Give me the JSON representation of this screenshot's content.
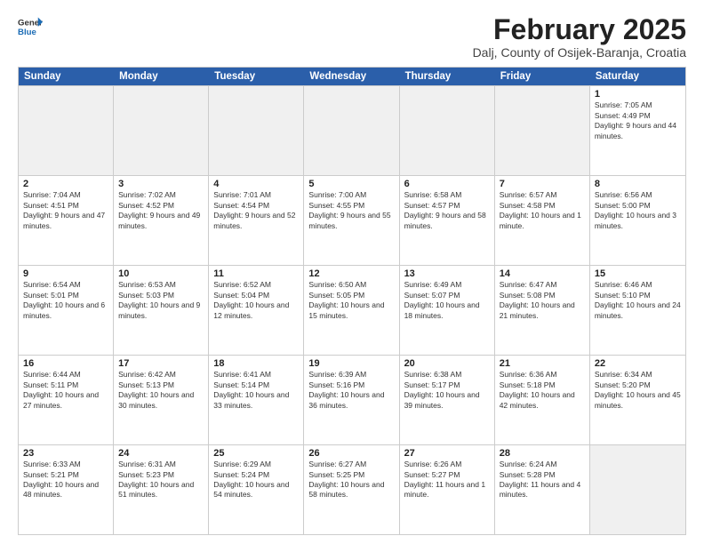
{
  "header": {
    "logo_general": "General",
    "logo_blue": "Blue",
    "main_title": "February 2025",
    "subtitle": "Dalj, County of Osijek-Baranja, Croatia"
  },
  "days_of_week": [
    "Sunday",
    "Monday",
    "Tuesday",
    "Wednesday",
    "Thursday",
    "Friday",
    "Saturday"
  ],
  "weeks": [
    [
      {
        "day": "",
        "info": "",
        "shaded": true
      },
      {
        "day": "",
        "info": "",
        "shaded": true
      },
      {
        "day": "",
        "info": "",
        "shaded": true
      },
      {
        "day": "",
        "info": "",
        "shaded": true
      },
      {
        "day": "",
        "info": "",
        "shaded": true
      },
      {
        "day": "",
        "info": "",
        "shaded": true
      },
      {
        "day": "1",
        "info": "Sunrise: 7:05 AM\nSunset: 4:49 PM\nDaylight: 9 hours and 44 minutes."
      }
    ],
    [
      {
        "day": "2",
        "info": "Sunrise: 7:04 AM\nSunset: 4:51 PM\nDaylight: 9 hours and 47 minutes."
      },
      {
        "day": "3",
        "info": "Sunrise: 7:02 AM\nSunset: 4:52 PM\nDaylight: 9 hours and 49 minutes."
      },
      {
        "day": "4",
        "info": "Sunrise: 7:01 AM\nSunset: 4:54 PM\nDaylight: 9 hours and 52 minutes."
      },
      {
        "day": "5",
        "info": "Sunrise: 7:00 AM\nSunset: 4:55 PM\nDaylight: 9 hours and 55 minutes."
      },
      {
        "day": "6",
        "info": "Sunrise: 6:58 AM\nSunset: 4:57 PM\nDaylight: 9 hours and 58 minutes."
      },
      {
        "day": "7",
        "info": "Sunrise: 6:57 AM\nSunset: 4:58 PM\nDaylight: 10 hours and 1 minute."
      },
      {
        "day": "8",
        "info": "Sunrise: 6:56 AM\nSunset: 5:00 PM\nDaylight: 10 hours and 3 minutes."
      }
    ],
    [
      {
        "day": "9",
        "info": "Sunrise: 6:54 AM\nSunset: 5:01 PM\nDaylight: 10 hours and 6 minutes."
      },
      {
        "day": "10",
        "info": "Sunrise: 6:53 AM\nSunset: 5:03 PM\nDaylight: 10 hours and 9 minutes."
      },
      {
        "day": "11",
        "info": "Sunrise: 6:52 AM\nSunset: 5:04 PM\nDaylight: 10 hours and 12 minutes."
      },
      {
        "day": "12",
        "info": "Sunrise: 6:50 AM\nSunset: 5:05 PM\nDaylight: 10 hours and 15 minutes."
      },
      {
        "day": "13",
        "info": "Sunrise: 6:49 AM\nSunset: 5:07 PM\nDaylight: 10 hours and 18 minutes."
      },
      {
        "day": "14",
        "info": "Sunrise: 6:47 AM\nSunset: 5:08 PM\nDaylight: 10 hours and 21 minutes."
      },
      {
        "day": "15",
        "info": "Sunrise: 6:46 AM\nSunset: 5:10 PM\nDaylight: 10 hours and 24 minutes."
      }
    ],
    [
      {
        "day": "16",
        "info": "Sunrise: 6:44 AM\nSunset: 5:11 PM\nDaylight: 10 hours and 27 minutes."
      },
      {
        "day": "17",
        "info": "Sunrise: 6:42 AM\nSunset: 5:13 PM\nDaylight: 10 hours and 30 minutes."
      },
      {
        "day": "18",
        "info": "Sunrise: 6:41 AM\nSunset: 5:14 PM\nDaylight: 10 hours and 33 minutes."
      },
      {
        "day": "19",
        "info": "Sunrise: 6:39 AM\nSunset: 5:16 PM\nDaylight: 10 hours and 36 minutes."
      },
      {
        "day": "20",
        "info": "Sunrise: 6:38 AM\nSunset: 5:17 PM\nDaylight: 10 hours and 39 minutes."
      },
      {
        "day": "21",
        "info": "Sunrise: 6:36 AM\nSunset: 5:18 PM\nDaylight: 10 hours and 42 minutes."
      },
      {
        "day": "22",
        "info": "Sunrise: 6:34 AM\nSunset: 5:20 PM\nDaylight: 10 hours and 45 minutes."
      }
    ],
    [
      {
        "day": "23",
        "info": "Sunrise: 6:33 AM\nSunset: 5:21 PM\nDaylight: 10 hours and 48 minutes."
      },
      {
        "day": "24",
        "info": "Sunrise: 6:31 AM\nSunset: 5:23 PM\nDaylight: 10 hours and 51 minutes."
      },
      {
        "day": "25",
        "info": "Sunrise: 6:29 AM\nSunset: 5:24 PM\nDaylight: 10 hours and 54 minutes."
      },
      {
        "day": "26",
        "info": "Sunrise: 6:27 AM\nSunset: 5:25 PM\nDaylight: 10 hours and 58 minutes."
      },
      {
        "day": "27",
        "info": "Sunrise: 6:26 AM\nSunset: 5:27 PM\nDaylight: 11 hours and 1 minute."
      },
      {
        "day": "28",
        "info": "Sunrise: 6:24 AM\nSunset: 5:28 PM\nDaylight: 11 hours and 4 minutes."
      },
      {
        "day": "",
        "info": "",
        "shaded": true
      }
    ]
  ]
}
